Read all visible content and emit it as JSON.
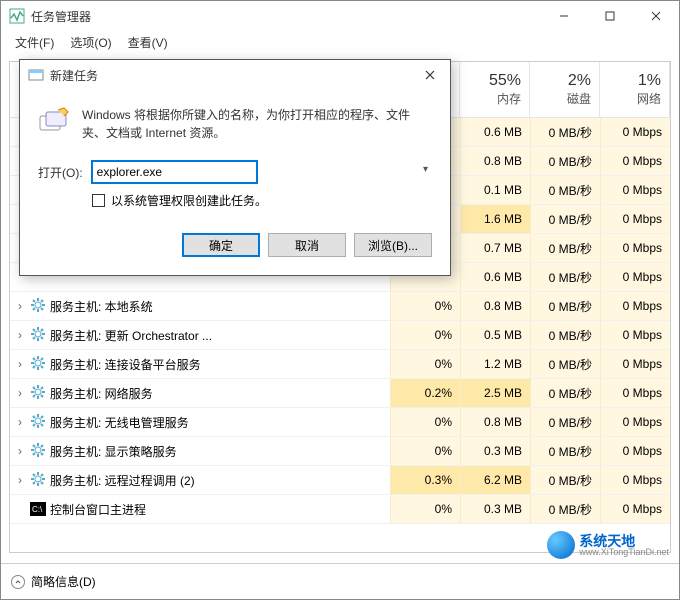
{
  "window": {
    "title": "任务管理器",
    "menu": {
      "file": "文件(F)",
      "options": "选项(O)",
      "view": "查看(V)"
    }
  },
  "columns": {
    "cpu": {
      "value": "",
      "label": ""
    },
    "mem": {
      "value": "55%",
      "label": "内存"
    },
    "disk": {
      "value": "2%",
      "label": "磁盘"
    },
    "net": {
      "value": "1%",
      "label": "网络"
    }
  },
  "rows": [
    {
      "name": "",
      "cpu": "",
      "mem": "0.6 MB",
      "disk": "0 MB/秒",
      "net": "0 Mbps",
      "icon": "hidden"
    },
    {
      "name": "",
      "cpu": "",
      "mem": "0.8 MB",
      "disk": "0 MB/秒",
      "net": "0 Mbps",
      "icon": "hidden"
    },
    {
      "name": "",
      "cpu": "",
      "mem": "0.1 MB",
      "disk": "0 MB/秒",
      "net": "0 Mbps",
      "icon": "hidden"
    },
    {
      "name": "",
      "cpu": "",
      "mem": "1.6 MB",
      "disk": "0 MB/秒",
      "net": "0 Mbps",
      "icon": "hidden",
      "memhot": true
    },
    {
      "name": "",
      "cpu": "",
      "mem": "0.7 MB",
      "disk": "0 MB/秒",
      "net": "0 Mbps",
      "icon": "hidden"
    },
    {
      "name": "",
      "cpu": "",
      "mem": "0.6 MB",
      "disk": "0 MB/秒",
      "net": "0 Mbps",
      "icon": "hidden"
    },
    {
      "name": "服务主机: 本地系统",
      "cpu": "0%",
      "mem": "0.8 MB",
      "disk": "0 MB/秒",
      "net": "0 Mbps",
      "icon": "gear",
      "expand": true
    },
    {
      "name": "服务主机: 更新 Orchestrator ...",
      "cpu": "0%",
      "mem": "0.5 MB",
      "disk": "0 MB/秒",
      "net": "0 Mbps",
      "icon": "gear",
      "expand": true
    },
    {
      "name": "服务主机: 连接设备平台服务",
      "cpu": "0%",
      "mem": "1.2 MB",
      "disk": "0 MB/秒",
      "net": "0 Mbps",
      "icon": "gear",
      "expand": true
    },
    {
      "name": "服务主机: 网络服务",
      "cpu": "0.2%",
      "mem": "2.5 MB",
      "disk": "0 MB/秒",
      "net": "0 Mbps",
      "icon": "gear",
      "expand": true,
      "cpuhot": true,
      "memhot": true
    },
    {
      "name": "服务主机: 无线电管理服务",
      "cpu": "0%",
      "mem": "0.8 MB",
      "disk": "0 MB/秒",
      "net": "0 Mbps",
      "icon": "gear",
      "expand": true
    },
    {
      "name": "服务主机: 显示策略服务",
      "cpu": "0%",
      "mem": "0.3 MB",
      "disk": "0 MB/秒",
      "net": "0 Mbps",
      "icon": "gear",
      "expand": true
    },
    {
      "name": "服务主机: 远程过程调用 (2)",
      "cpu": "0.3%",
      "mem": "6.2 MB",
      "disk": "0 MB/秒",
      "net": "0 Mbps",
      "icon": "gear",
      "expand": true,
      "cpuhot": true,
      "memhot": true
    },
    {
      "name": "控制台窗口主进程",
      "cpu": "0%",
      "mem": "0.3 MB",
      "disk": "0 MB/秒",
      "net": "0 Mbps",
      "icon": "cmd",
      "expand": false
    }
  ],
  "statusbar": {
    "label": "简略信息(D)"
  },
  "dialog": {
    "title": "新建任务",
    "desc": "Windows 将根据你所键入的名称，为你打开相应的程序、文件夹、文档或 Internet 资源。",
    "open_label": "打开(O):",
    "input_value": "explorer.exe",
    "checkbox_label": "以系统管理权限创建此任务。",
    "btn_ok": "确定",
    "btn_cancel": "取消",
    "btn_browse": "浏览(B)..."
  },
  "watermark": {
    "brand": "系统天地",
    "url": "www.XiTongTianDi.net"
  }
}
